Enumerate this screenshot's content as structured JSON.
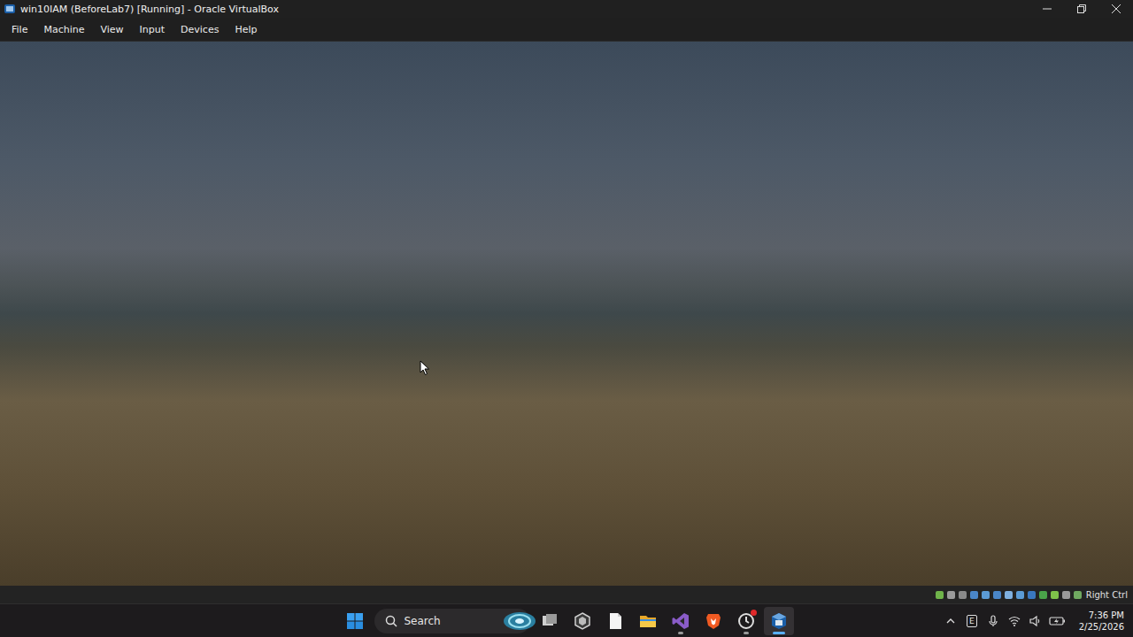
{
  "window": {
    "title": "win10IAM (BeforeLab7) [Running] - Oracle VirtualBox"
  },
  "menu": [
    "File",
    "Machine",
    "View",
    "Input",
    "Devices",
    "Help"
  ],
  "vm_status_bar": {
    "host_key": "Right Ctrl"
  },
  "taskbar": {
    "search": {
      "placeholder": "Search"
    },
    "apps": [
      {
        "kind": "taskview",
        "running": false,
        "selected": false,
        "notification": false
      },
      {
        "kind": "hexagon",
        "running": false,
        "selected": false,
        "notification": false
      },
      {
        "kind": "notepad",
        "running": false,
        "selected": false,
        "notification": false
      },
      {
        "kind": "explorer",
        "running": false,
        "selected": false,
        "notification": false
      },
      {
        "kind": "visualstudio",
        "running": true,
        "selected": false,
        "notification": false
      },
      {
        "kind": "brave",
        "running": false,
        "selected": false,
        "notification": false
      },
      {
        "kind": "clock",
        "running": true,
        "selected": false,
        "notification": true
      },
      {
        "kind": "virtualbox",
        "running": true,
        "selected": true,
        "notification": false
      }
    ],
    "tray": [
      {
        "kind": "chevron"
      },
      {
        "kind": "letter",
        "label": "E"
      },
      {
        "kind": "mic"
      },
      {
        "kind": "wifi"
      },
      {
        "kind": "speaker"
      },
      {
        "kind": "battery"
      }
    ],
    "clock": {
      "time": "7:36 PM",
      "date": "2/25/2026"
    }
  }
}
